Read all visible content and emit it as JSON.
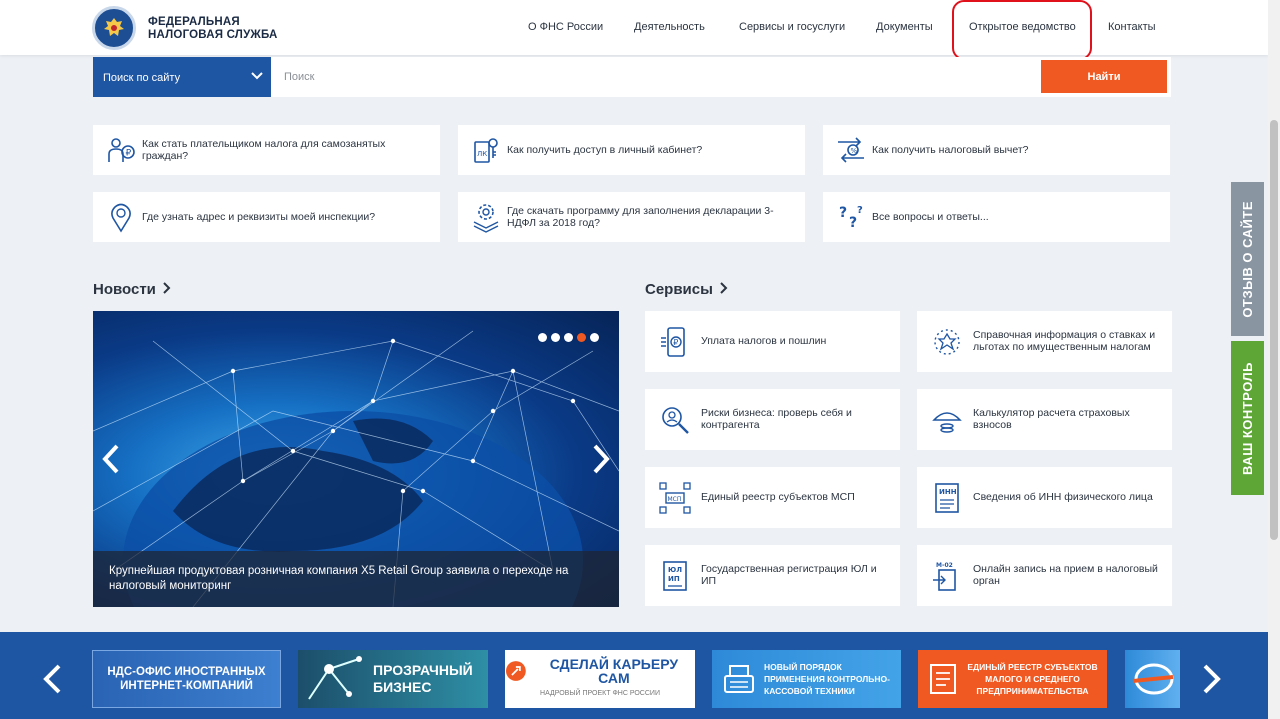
{
  "header": {
    "logo_line1": "ФЕДЕРАЛЬНАЯ",
    "logo_line2": "НАЛОГОВАЯ СЛУЖБА",
    "nav": [
      "О ФНС России",
      "Деятельность",
      "Сервисы и госуслуги",
      "Документы",
      "Открытое ведомство",
      "Контакты"
    ]
  },
  "search": {
    "scope_label": "Поиск по сайту",
    "placeholder": "Поиск",
    "button_label": "Найти"
  },
  "questions": [
    "Как стать плательщиком налога для самозанятых граждан?",
    "Как получить доступ в личный кабинет?",
    "Как получить налоговый вычет?",
    "Где узнать адрес и реквизиты моей инспекции?",
    "Где скачать программу для заполнения декларации 3-НДФЛ за 2018 год?",
    "Все вопросы и ответы..."
  ],
  "news": {
    "title": "Новости",
    "caption": "Крупнейшая продуктовая розничная компания X5 Retail Group заявила о переходе на налоговый мониторинг",
    "slide_count": 5,
    "active_slide": 4
  },
  "services": {
    "title": "Сервисы",
    "items": [
      "Уплата налогов и пошлин",
      "Справочная информация о ставках и льготах по имущественным налогам",
      "Риски бизнеса: проверь себя и контрагента",
      "Калькулятор расчета страховых взносов",
      "Единый реестр субъектов МСП",
      "Сведения об ИНН физического лица",
      "Государственная регистрация ЮЛ и ИП",
      "Онлайн запись на прием в налоговый орган"
    ]
  },
  "side_tabs": {
    "feedback": "ОТЗЫВ О САЙТЕ",
    "control": "ВАШ КОНТРОЛЬ"
  },
  "banners": {
    "b1": "НДС-ОФИС ИНОСТРАННЫХ ИНТЕРНЕТ-КОМПАНИЙ",
    "b2": "ПРОЗРАЧНЫЙ БИЗНЕС",
    "b3": "СДЕЛАЙ КАРЬЕРУ САМ",
    "b3_sub": "НАДРОВЫЙ ПРОЕКТ ФНС РОССИИ",
    "b4": "НОВЫЙ ПОРЯДОК ПРИМЕНЕНИЯ КОНТРОЛЬНО-КАССОВОЙ ТЕХНИКИ",
    "b5": "ЕДИНЫЙ РЕЕСТР СУБЪЕКТОВ МАЛОГО И СРЕДНЕГО ПРЕДПРИНИМАТЕЛЬСТВА"
  },
  "colors": {
    "brand_blue": "#1f56a3",
    "accent_orange": "#f05a22",
    "control_green": "#5ea636",
    "highlight_red": "#e0111b"
  }
}
